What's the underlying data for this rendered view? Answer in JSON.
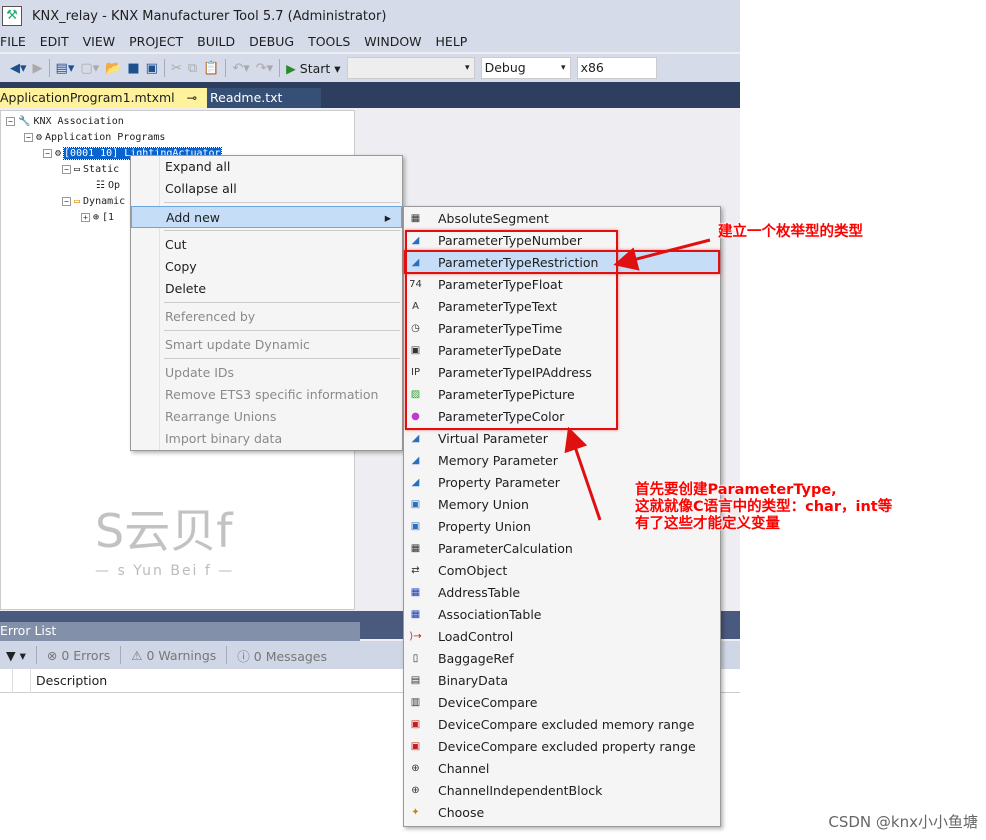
{
  "window": {
    "title": "KNX_relay - KNX Manufacturer Tool 5.7 (Administrator)"
  },
  "menubar": [
    "FILE",
    "EDIT",
    "VIEW",
    "PROJECT",
    "BUILD",
    "DEBUG",
    "TOOLS",
    "WINDOW",
    "HELP"
  ],
  "toolbar": {
    "start_label": "Start",
    "config_value": "Debug",
    "platform_value": "x86",
    "target_value": ""
  },
  "tabs": [
    {
      "label": "ApplicationProgram1.mtxml",
      "active": true
    },
    {
      "label": "Readme.txt",
      "active": false
    }
  ],
  "tree": {
    "root": "KNX Association",
    "app_programs": "Application Programs",
    "program": "[0001 10] LightingActuator",
    "static": "Static",
    "static_child": "Op",
    "dynamic": "Dynamic",
    "dynamic_child": "[1"
  },
  "context_menu": {
    "items": [
      {
        "label": "Expand all",
        "enabled": true
      },
      {
        "label": "Collapse all",
        "enabled": true
      },
      {
        "label": "Add new",
        "enabled": true,
        "highlighted": true,
        "submenu": true
      },
      {
        "label": "Cut",
        "enabled": true
      },
      {
        "label": "Copy",
        "enabled": true
      },
      {
        "label": "Delete",
        "enabled": true
      },
      {
        "label": "Referenced by",
        "enabled": false
      },
      {
        "label": "Smart update Dynamic",
        "enabled": false
      },
      {
        "label": "Update IDs",
        "enabled": false
      },
      {
        "label": "Remove ETS3 specific information",
        "enabled": false
      },
      {
        "label": "Rearrange Unions",
        "enabled": false
      },
      {
        "label": "Import binary data",
        "enabled": false
      }
    ]
  },
  "submenu": {
    "items": [
      {
        "label": "AbsoluteSegment",
        "icon": "segment-icon"
      },
      {
        "label": "ParameterTypeNumber",
        "icon": "param-type-icon"
      },
      {
        "label": "ParameterTypeRestriction",
        "icon": "param-type-icon",
        "highlighted": true
      },
      {
        "label": "ParameterTypeFloat",
        "icon": "float-icon"
      },
      {
        "label": "ParameterTypeText",
        "icon": "text-icon"
      },
      {
        "label": "ParameterTypeTime",
        "icon": "clock-icon"
      },
      {
        "label": "ParameterTypeDate",
        "icon": "date-icon"
      },
      {
        "label": "ParameterTypeIPAddress",
        "icon": "ip-icon"
      },
      {
        "label": "ParameterTypePicture",
        "icon": "picture-icon"
      },
      {
        "label": "ParameterTypeColor",
        "icon": "color-icon"
      },
      {
        "label": "Virtual Parameter",
        "icon": "param-icon"
      },
      {
        "label": "Memory Parameter",
        "icon": "param-icon"
      },
      {
        "label": "Property Parameter",
        "icon": "param-icon"
      },
      {
        "label": "Memory Union",
        "icon": "union-icon"
      },
      {
        "label": "Property Union",
        "icon": "union-icon"
      },
      {
        "label": "ParameterCalculation",
        "icon": "calculator-icon"
      },
      {
        "label": "ComObject",
        "icon": "comobject-icon"
      },
      {
        "label": "AddressTable",
        "icon": "table-icon"
      },
      {
        "label": "AssociationTable",
        "icon": "table-icon"
      },
      {
        "label": "LoadControl",
        "icon": "load-icon"
      },
      {
        "label": "BaggageRef",
        "icon": "file-icon"
      },
      {
        "label": "BinaryData",
        "icon": "binary-icon"
      },
      {
        "label": "DeviceCompare",
        "icon": "compare-icon"
      },
      {
        "label": "DeviceCompare excluded memory range",
        "icon": "exclude-icon"
      },
      {
        "label": "DeviceCompare excluded property range",
        "icon": "exclude-icon"
      },
      {
        "label": "Channel",
        "icon": "channel-icon"
      },
      {
        "label": "ChannelIndependentBlock",
        "icon": "channel-icon"
      },
      {
        "label": "Choose",
        "icon": "choose-icon"
      }
    ]
  },
  "error_list": {
    "title": "Error List",
    "errors": "0 Errors",
    "warnings": "0 Warnings",
    "messages": "0 Messages",
    "column": "Description"
  },
  "annotations": {
    "top": "建立一个枚举型的类型",
    "bottom": [
      "首先要创建ParameterType,",
      "这就就像C语言中的类型：char，int等",
      "有了这些才能定义变量"
    ]
  },
  "watermark": {
    "main": "S云贝f",
    "sub": "— s Yun Bei f —",
    "credit": "CSDN @knx小小鱼塘"
  },
  "colors": {
    "accent": "#0a64d0",
    "annotation": "#ff0000",
    "highlight": "#c5ddf6"
  }
}
